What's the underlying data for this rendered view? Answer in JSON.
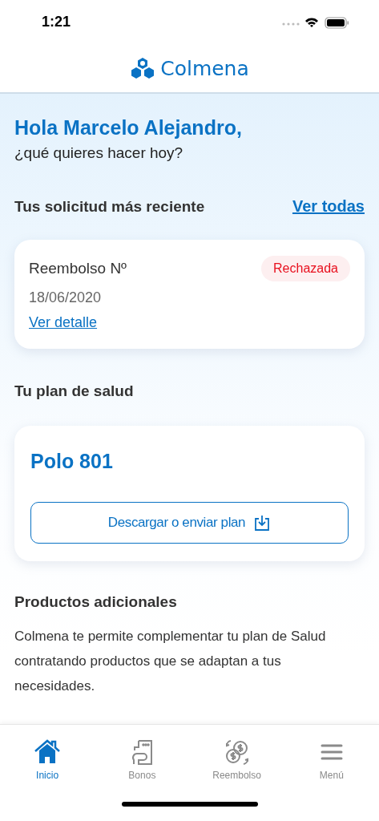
{
  "status_bar": {
    "time": "1:21"
  },
  "header": {
    "brand": "Colmena"
  },
  "greeting": {
    "title": "Hola Marcelo Alejandro,",
    "subtitle": "¿qué quieres hacer hoy?"
  },
  "recent_request": {
    "heading": "Tus solicitud más reciente",
    "link": "Ver todas",
    "card": {
      "title": "Reembolso Nº",
      "date": "18/06/2020",
      "status": {
        "label": "Rechazada",
        "kind": "rejected"
      },
      "link": "Ver detalle"
    }
  },
  "health_plan": {
    "heading": "Tu plan de salud",
    "plan_name": "Polo 801",
    "button": "Descargar o enviar plan"
  },
  "additional_products": {
    "heading": "Productos adicionales",
    "body": "Colmena te permite complementar tu plan de Salud contratando productos que se adaptan a tus necesidades."
  },
  "tab_bar": [
    {
      "label": "Inicio",
      "selected": true
    },
    {
      "label": "Bonos",
      "selected": false
    },
    {
      "label": "Reembolso",
      "selected": false
    },
    {
      "label": "Menú",
      "selected": false
    }
  ]
}
